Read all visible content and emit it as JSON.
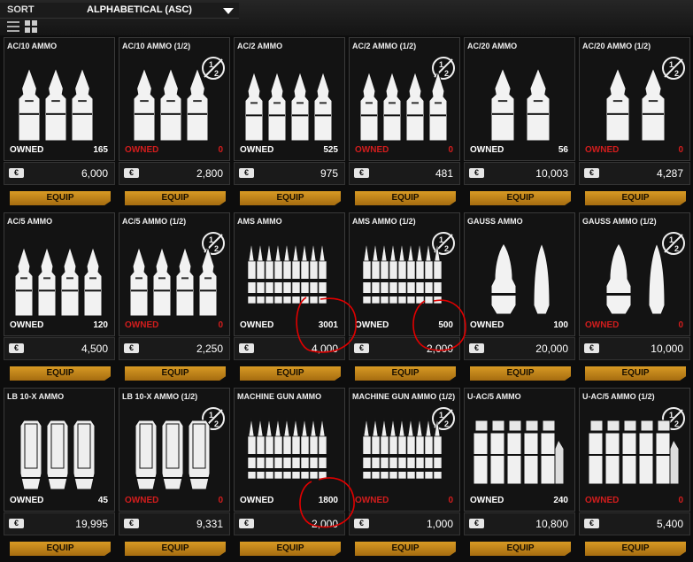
{
  "sort": {
    "label": "SORT",
    "value": "ALPHABETICAL (ASC)"
  },
  "currency_symbol": "€",
  "equip_label": "EQUIP",
  "owned_label": "OWNED",
  "colors": {
    "accent": "#c98a1c",
    "zero_owned": "#d31d1d",
    "annotation": "#e00000"
  },
  "items": [
    {
      "name": "AC/10 AMMO",
      "owned": "165",
      "price": "6,000",
      "half": false,
      "icon": "shell-triple"
    },
    {
      "name": "AC/10 AMMO (1/2)",
      "owned": "0",
      "price": "2,800",
      "half": true,
      "icon": "shell-triple"
    },
    {
      "name": "AC/2 AMMO",
      "owned": "525",
      "price": "975",
      "half": false,
      "icon": "shell-quad"
    },
    {
      "name": "AC/2 AMMO (1/2)",
      "owned": "0",
      "price": "481",
      "half": true,
      "icon": "shell-quad"
    },
    {
      "name": "AC/20 AMMO",
      "owned": "56",
      "price": "10,003",
      "half": false,
      "icon": "shell-double"
    },
    {
      "name": "AC/20 AMMO (1/2)",
      "owned": "0",
      "price": "4,287",
      "half": true,
      "icon": "shell-double"
    },
    {
      "name": "AC/5 AMMO",
      "owned": "120",
      "price": "4,500",
      "half": false,
      "icon": "shell-quad"
    },
    {
      "name": "AC/5 AMMO (1/2)",
      "owned": "0",
      "price": "2,250",
      "half": true,
      "icon": "shell-quad"
    },
    {
      "name": "AMS AMMO",
      "owned": "3001",
      "price": "4,000",
      "half": false,
      "icon": "belt"
    },
    {
      "name": "AMS AMMO (1/2)",
      "owned": "500",
      "price": "2,000",
      "half": true,
      "icon": "belt"
    },
    {
      "name": "GAUSS AMMO",
      "owned": "100",
      "price": "20,000",
      "half": false,
      "icon": "gauss"
    },
    {
      "name": "GAUSS AMMO (1/2)",
      "owned": "0",
      "price": "10,000",
      "half": true,
      "icon": "gauss"
    },
    {
      "name": "LB 10-X AMMO",
      "owned": "45",
      "price": "19,995",
      "half": false,
      "icon": "lbx"
    },
    {
      "name": "LB 10-X AMMO (1/2)",
      "owned": "0",
      "price": "9,331",
      "half": true,
      "icon": "lbx"
    },
    {
      "name": "MACHINE GUN AMMO",
      "owned": "1800",
      "price": "2,000",
      "half": false,
      "icon": "belt"
    },
    {
      "name": "MACHINE GUN AMMO (1/2)",
      "owned": "0",
      "price": "1,000",
      "half": true,
      "icon": "belt"
    },
    {
      "name": "U-AC/5 AMMO",
      "owned": "240",
      "price": "10,800",
      "half": false,
      "icon": "uac"
    },
    {
      "name": "U-AC/5 AMMO (1/2)",
      "owned": "0",
      "price": "5,400",
      "half": true,
      "icon": "uac"
    }
  ]
}
